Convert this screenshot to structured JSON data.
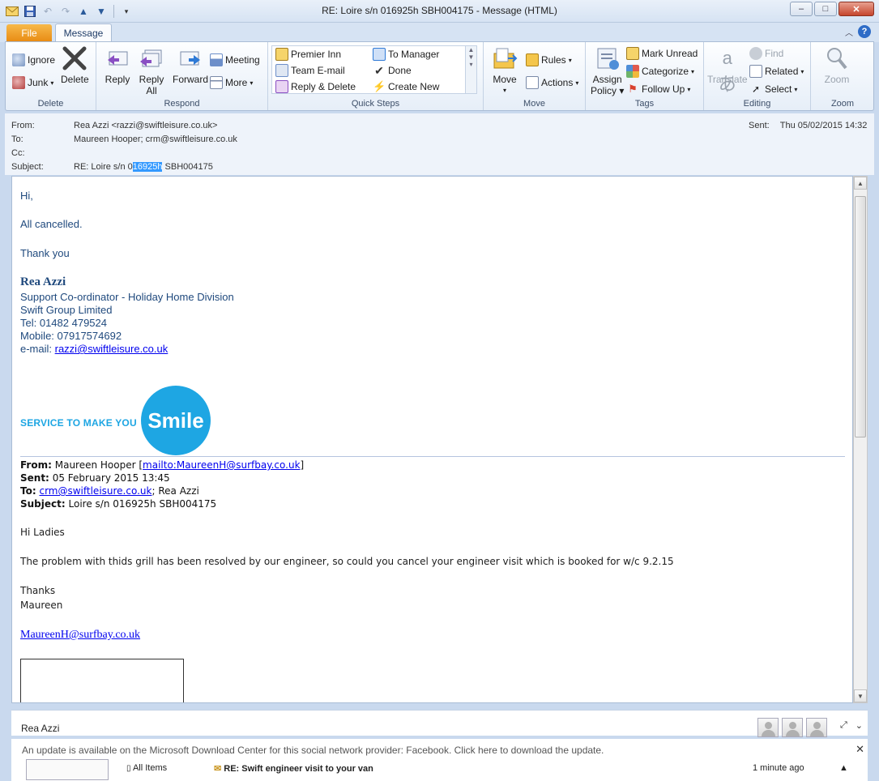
{
  "window": {
    "title": "RE: Loire  s/n 016925h SBH004175  -  Message (HTML)",
    "controls": [
      "–",
      "□",
      "✕"
    ]
  },
  "tabs": {
    "file": "File",
    "message": "Message"
  },
  "ribbon": {
    "delete": {
      "label": "Delete",
      "ignore": "Ignore",
      "junk": "Junk",
      "delete_btn": "Delete"
    },
    "respond": {
      "label": "Respond",
      "reply": "Reply",
      "reply_all_1": "Reply",
      "reply_all_2": "All",
      "forward": "Forward",
      "meeting": "Meeting",
      "more": "More"
    },
    "quick_steps": {
      "label": "Quick Steps",
      "items": [
        "Premier Inn",
        "Team E-mail",
        "Reply & Delete",
        "To Manager",
        "Done",
        "Create New"
      ]
    },
    "move": {
      "label": "Move",
      "move": "Move",
      "rules": "Rules",
      "actions": "Actions"
    },
    "tags": {
      "label": "Tags",
      "assign_1": "Assign",
      "assign_2": "Policy",
      "mark_unread": "Mark Unread",
      "categorize": "Categorize",
      "follow_up": "Follow Up"
    },
    "editing": {
      "label": "Editing",
      "translate": "Translate",
      "find": "Find",
      "related": "Related",
      "select": "Select"
    },
    "zoom": {
      "label": "Zoom",
      "zoom": "Zoom"
    }
  },
  "header": {
    "from_label": "From:",
    "from": "Rea Azzi <razzi@swiftleisure.co.uk>",
    "to_label": "To:",
    "to": "Maureen Hooper; crm@swiftleisure.co.uk",
    "cc_label": "Cc:",
    "cc": "",
    "subject_label": "Subject:",
    "subject_pre": "RE: Loire  s/n 0",
    "subject_sel": "16925h",
    "subject_post": " SBH004175",
    "sent_label": "Sent:",
    "sent": "Thu 05/02/2015 14:32"
  },
  "body": {
    "greeting": "Hi,",
    "line1": "All cancelled.",
    "thanks": "Thank you",
    "sig_name": "Rea Azzi",
    "sig_title": "Support Co-ordinator - Holiday Home Division",
    "sig_company": "Swift Group Limited",
    "sig_tel": "Tel: 01482 479524",
    "sig_mobile": "Mobile: 07917574692",
    "sig_email_label": "e-mail: ",
    "sig_email": "razzi@swiftleisure.co.uk",
    "banner_text": "SERVICE TO MAKE YOU",
    "banner_logo": "Smile",
    "fwd_from_label": "From:",
    "fwd_from": "Maureen Hooper [",
    "fwd_from_link": "mailto:MaureenH@surfbay.co.uk",
    "fwd_from_end": "]",
    "fwd_sent_label": "Sent:",
    "fwd_sent": "05 February 2015 13:45",
    "fwd_to_label": "To:",
    "fwd_to_link": "crm@swiftleisure.co.uk",
    "fwd_to_rest": "; Rea Azzi",
    "fwd_subject_label": "Subject:",
    "fwd_subject": "Loire s/n 016925h SBH004175",
    "fwd_greeting": "Hi Ladies",
    "fwd_text": "The problem with thids grill has been resolved by our engineer, so could you cancel your engineer visit which is booked for w/c 9.2.15",
    "fwd_thanks": "Thanks",
    "fwd_name": "Maureen",
    "fwd_email": "MaureenH@surfbay.co.uk"
  },
  "people_pane": {
    "name": "Rea Azzi"
  },
  "update_bar": {
    "text": "An update is available on the Microsoft Download Center for this social network provider: Facebook. Click here to download the update."
  },
  "bottom_strip": {
    "folder": "All Items",
    "item": "RE: Swift engineer visit to your van",
    "time": "1 minute ago"
  },
  "colors": {
    "accent": "#1ea6e3",
    "file_tab": "#e88a12",
    "link": "#0000ee",
    "signature": "#1f497d"
  }
}
